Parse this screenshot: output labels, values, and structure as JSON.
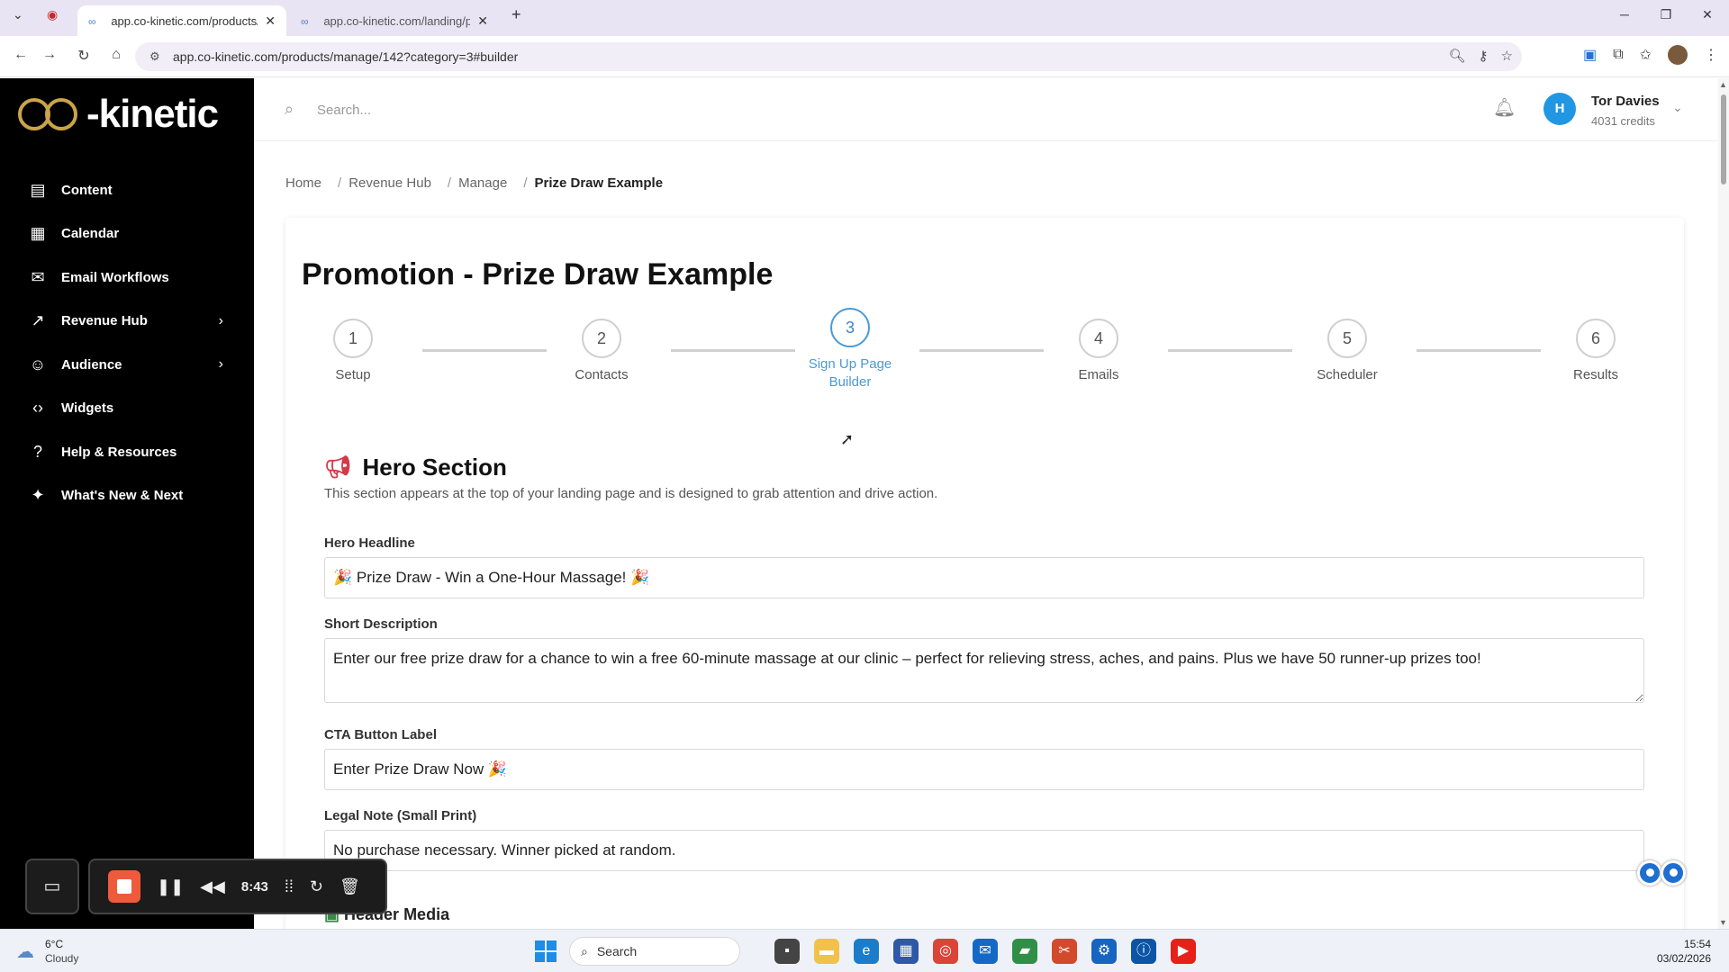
{
  "browser": {
    "tabs": [
      {
        "title": "app.co-kinetic.com/products/m",
        "active": true
      },
      {
        "title": "app.co-kinetic.com/landing/pr",
        "active": false
      }
    ],
    "url": "app.co-kinetic.com/products/manage/142?category=3#builder"
  },
  "sidebar": {
    "logo_text": "-kinetic",
    "items": [
      {
        "label": "Content",
        "icon": "document-icon"
      },
      {
        "label": "Calendar",
        "icon": "calendar-icon"
      },
      {
        "label": "Email Workflows",
        "icon": "mail-icon"
      },
      {
        "label": "Revenue Hub",
        "icon": "trend-icon",
        "has_children": true
      },
      {
        "label": "Audience",
        "icon": "users-icon",
        "has_children": true
      },
      {
        "label": "Widgets",
        "icon": "code-icon"
      },
      {
        "label": "Help & Resources",
        "icon": "help-icon"
      },
      {
        "label": "What's New & Next",
        "icon": "sparkle-icon"
      }
    ]
  },
  "header": {
    "search_placeholder": "Search...",
    "user": {
      "initial": "H",
      "name": "Tor Davies",
      "credits": "4031 credits"
    }
  },
  "breadcrumb": [
    "Home",
    "Revenue Hub",
    "Manage",
    "Prize Draw Example"
  ],
  "page": {
    "title": "Promotion - Prize Draw Example",
    "steps": [
      {
        "number": "1",
        "label": "Setup"
      },
      {
        "number": "2",
        "label": "Contacts"
      },
      {
        "number": "3",
        "label": "Sign Up Page Builder",
        "active": true
      },
      {
        "number": "4",
        "label": "Emails"
      },
      {
        "number": "5",
        "label": "Scheduler"
      },
      {
        "number": "6",
        "label": "Results"
      }
    ],
    "section": {
      "title": "Hero Section",
      "description": "This section appears at the top of your landing page and is designed to grab attention and drive action."
    },
    "fields": {
      "hero_headline_label": "Hero Headline",
      "hero_headline_value": "🎉 Prize Draw - Win a One-Hour Massage! 🎉",
      "short_description_label": "Short Description",
      "short_description_value": "Enter our free prize draw for a chance to win a free 60-minute massage at our clinic – perfect for relieving stress, aches, and pains. Plus we have 50 runner-up prizes too!",
      "cta_label": "CTA Button Label",
      "cta_value": "Enter Prize Draw Now 🎉",
      "legal_label": "Legal Note (Small Print)",
      "legal_value": "No purchase necessary. Winner picked at random."
    },
    "next_section": "Header Media"
  },
  "recorder": {
    "time": "8:43"
  },
  "taskbar": {
    "weather_temp": "6°C",
    "weather_desc": "Cloudy",
    "search_label": "Search",
    "time": "15:54",
    "date": "03/02/2026"
  },
  "colors": {
    "accent": "#4a9ad6",
    "avatar": "#2196e3",
    "sidebar_bg": "#000000",
    "record": "#f05a3c"
  }
}
